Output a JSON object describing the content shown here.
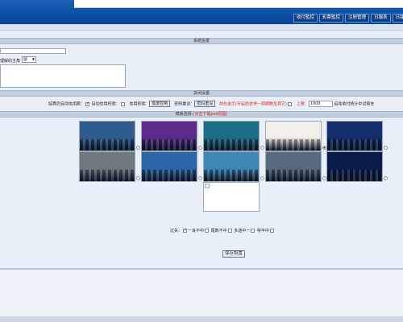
{
  "nav": {
    "buttons": [
      "收付監控",
      "彩票監控",
      "注冊管理",
      "日報表",
      "日報2"
    ]
  },
  "sections": {
    "system_settings": "系統設置",
    "close_settings": "关闭设置",
    "template_select_label": "模板选择:",
    "template_select_link": "(点击下载psd原图)"
  },
  "system": {
    "field_label": "理解的主角",
    "select_value": "鼠"
  },
  "close_row": {
    "label1": "结算后自动信用额：",
    "label2": "自动信用校验：",
    "label3": "信用校验：",
    "btn_credit": "额度控制",
    "label4": "密码重设：",
    "btn_pwd": "密码重设",
    "red_text": "前台显示(开启后会将一周期数及其它)",
    "upper_label": "上限：",
    "upper_value": "1000",
    "tail_text": "启动收付统计中试需在"
  },
  "templates": {
    "selected_index": 3,
    "colors": [
      "#2e5c8c",
      "#5b2a8a",
      "#1c6e86",
      "#f1efe8",
      "#152f6a",
      "#6f7a80",
      "#2c65a8",
      "#3e88b8",
      "#5a6a7e",
      "#0b1c4a"
    ]
  },
  "pass_row": {
    "label": "过关：",
    "opt1": "一肖不中",
    "opt2": "尾数不中",
    "opt3": "多选中一",
    "opt4": "特平中"
  },
  "save_button": "保存設置"
}
